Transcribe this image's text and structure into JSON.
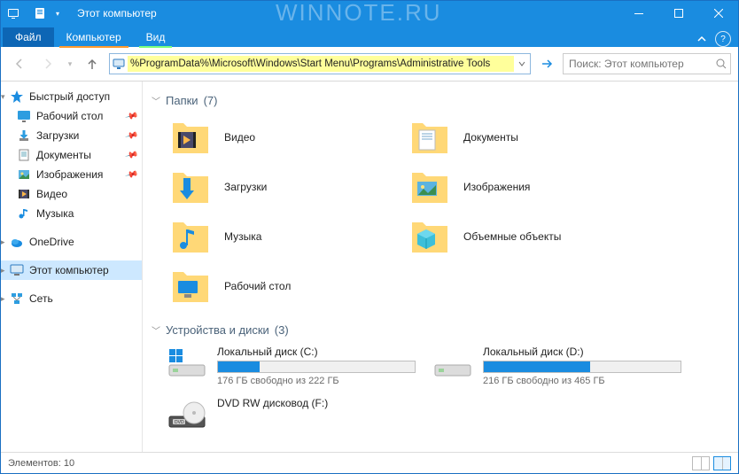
{
  "title": "Этот компьютер",
  "watermark": "WINNOTE.RU",
  "ribbon": {
    "file": "Файл",
    "tabs": [
      "Компьютер",
      "Вид"
    ]
  },
  "address": {
    "value": "%ProgramData%\\Microsoft\\Windows\\Start Menu\\Programs\\Administrative Tools"
  },
  "search": {
    "placeholder": "Поиск: Этот компьютер"
  },
  "sidebar": {
    "quick": {
      "header": "Быстрый доступ",
      "items": [
        {
          "label": "Рабочий стол",
          "pinned": true
        },
        {
          "label": "Загрузки",
          "pinned": true
        },
        {
          "label": "Документы",
          "pinned": true
        },
        {
          "label": "Изображения",
          "pinned": true
        },
        {
          "label": "Видео",
          "pinned": false
        },
        {
          "label": "Музыка",
          "pinned": false
        }
      ]
    },
    "onedrive": "OneDrive",
    "thispc": "Этот компьютер",
    "network": "Сеть"
  },
  "sections": {
    "folders": {
      "title": "Папки",
      "count": 7,
      "items": [
        {
          "label": "Видео"
        },
        {
          "label": "Документы"
        },
        {
          "label": "Загрузки"
        },
        {
          "label": "Изображения"
        },
        {
          "label": "Музыка"
        },
        {
          "label": "Объемные объекты"
        },
        {
          "label": "Рабочий стол"
        }
      ]
    },
    "drives": {
      "title": "Устройства и диски",
      "count": 3,
      "items": [
        {
          "name": "Локальный диск (C:)",
          "free": "176 ГБ свободно из 222 ГБ",
          "fill": 21,
          "type": "os"
        },
        {
          "name": "Локальный диск (D:)",
          "free": "216 ГБ свободно из 465 ГБ",
          "fill": 54,
          "type": "hdd"
        },
        {
          "name": "DVD RW дисковод (F:)",
          "free": "",
          "fill": 0,
          "type": "dvd"
        }
      ]
    }
  },
  "status": {
    "text": "Элементов: 10"
  }
}
